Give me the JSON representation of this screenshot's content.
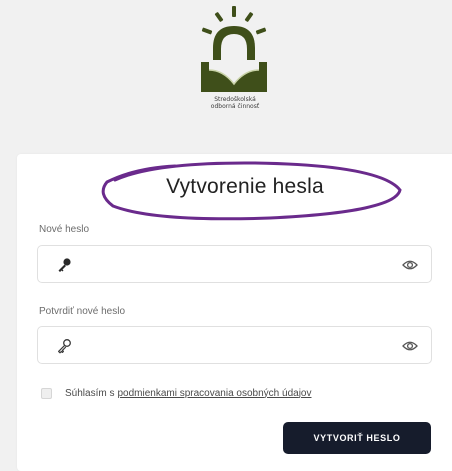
{
  "logo": {
    "caption_line1": "Stredoškolská",
    "caption_line2": "odborná činnosť"
  },
  "form": {
    "title": "Vytvorenie hesla",
    "new_password_label": "Nové heslo",
    "new_password_value": "",
    "confirm_password_label": "Potvrdiť nové heslo",
    "confirm_password_value": "",
    "consent_prefix": "Súhlasím s",
    "consent_link": "podmienkami spracovania osobných údajov",
    "submit_label": "VYTVORIŤ HESLO"
  },
  "icons": {
    "password_key": "key-icon",
    "show_password": "eye-icon",
    "logo": "sun-book-logo"
  },
  "colors": {
    "background": "#f1f1f1",
    "card": "#ffffff",
    "button": "#161c2c",
    "title_highlight": "#6a2a8c",
    "logo_green": "#3f4f1a"
  }
}
